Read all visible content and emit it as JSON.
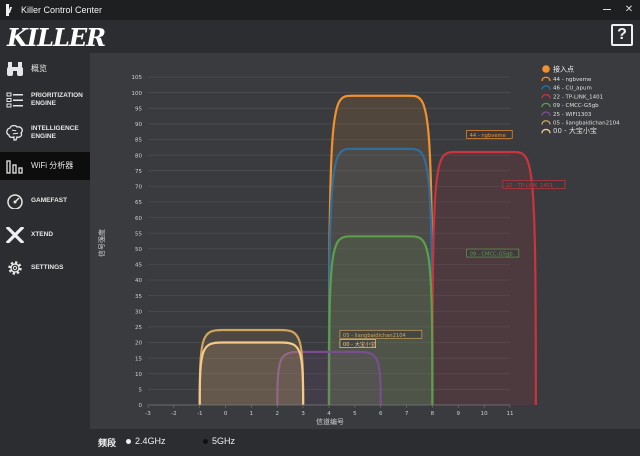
{
  "window": {
    "title": "Killer Control Center",
    "minimize_label": "",
    "close_label": "✕"
  },
  "header": {
    "logo_text": "KILLER",
    "help_label": "?"
  },
  "sidebar": {
    "items": [
      {
        "label": "概览",
        "icon": "binoculars-icon",
        "active": false
      },
      {
        "label": "PRIORITIZATION ENGINE",
        "icon": "priority-list-icon",
        "active": false
      },
      {
        "label": "INTELLIGENCE ENGINE",
        "icon": "brain-icon",
        "active": false
      },
      {
        "label": "WiFi 分析器",
        "icon": "bar-chart-icon",
        "active": true
      },
      {
        "label": "GAMEFAST",
        "icon": "speedometer-icon",
        "active": false
      },
      {
        "label": "XTEND",
        "icon": "x-icon",
        "active": false
      },
      {
        "label": "SETTINGS",
        "icon": "gear-icon",
        "active": false
      }
    ]
  },
  "footer": {
    "band_label": "频段",
    "options": [
      {
        "label": "2.4GHz",
        "selected": true
      },
      {
        "label": "5GHz",
        "selected": false
      }
    ]
  },
  "chart_data": {
    "type": "area",
    "title": "",
    "xlabel": "信道编号",
    "ylabel": "信号强度",
    "xlim": [
      -3,
      11
    ],
    "ylim": [
      0,
      105
    ],
    "x_ticks": [
      -3,
      -2,
      -1,
      0,
      1,
      2,
      3,
      4,
      5,
      6,
      7,
      8,
      9,
      10,
      11
    ],
    "y_ticks": [
      0,
      5,
      10,
      15,
      20,
      25,
      30,
      35,
      40,
      45,
      50,
      55,
      60,
      65,
      70,
      75,
      80,
      85,
      90,
      95,
      100,
      105
    ],
    "grid": true,
    "legend_position": "top-right",
    "legend_title": "接入点",
    "series": [
      {
        "name": "44 - ngbveme",
        "center": 6,
        "strength": 99,
        "color": "#f0912e"
      },
      {
        "name": "46 - CU_apum",
        "center": 6,
        "strength": 82,
        "color": "#2f6e9c"
      },
      {
        "name": "22 - TP-LINK_1401",
        "center": 10,
        "strength": 81,
        "color": "#c8343f"
      },
      {
        "name": "09 - CMCC-G5gb",
        "center": 6,
        "strength": 54,
        "color": "#5c9e4a"
      },
      {
        "name": "25 - WIFI1303",
        "center": 4,
        "strength": 17,
        "color": "#7a4e8e"
      },
      {
        "name": "05 - liangbaidichan2104",
        "center": 1,
        "strength": 24,
        "color": "#cfa45c"
      },
      {
        "name": "00 - 大宝小宝",
        "center": 1,
        "strength": 20,
        "color": "#f5c98a"
      }
    ],
    "point_labels": [
      {
        "text": "44 - ngbveme",
        "series": 0,
        "at_x": 9.4,
        "at_y": 86
      },
      {
        "text": "22 - TP-LINK_1401",
        "series": 2,
        "at_x": 10.8,
        "at_y": 70
      },
      {
        "text": "09 - CMCC-G5gb",
        "series": 3,
        "at_x": 9.4,
        "at_y": 48
      },
      {
        "text": "05 - liangbaidichan2104",
        "series": 5,
        "at_x": 4.5,
        "at_y": 22
      },
      {
        "text": "00 - 大宝小宝",
        "series": 6,
        "at_x": 4.5,
        "at_y": 19
      }
    ]
  }
}
